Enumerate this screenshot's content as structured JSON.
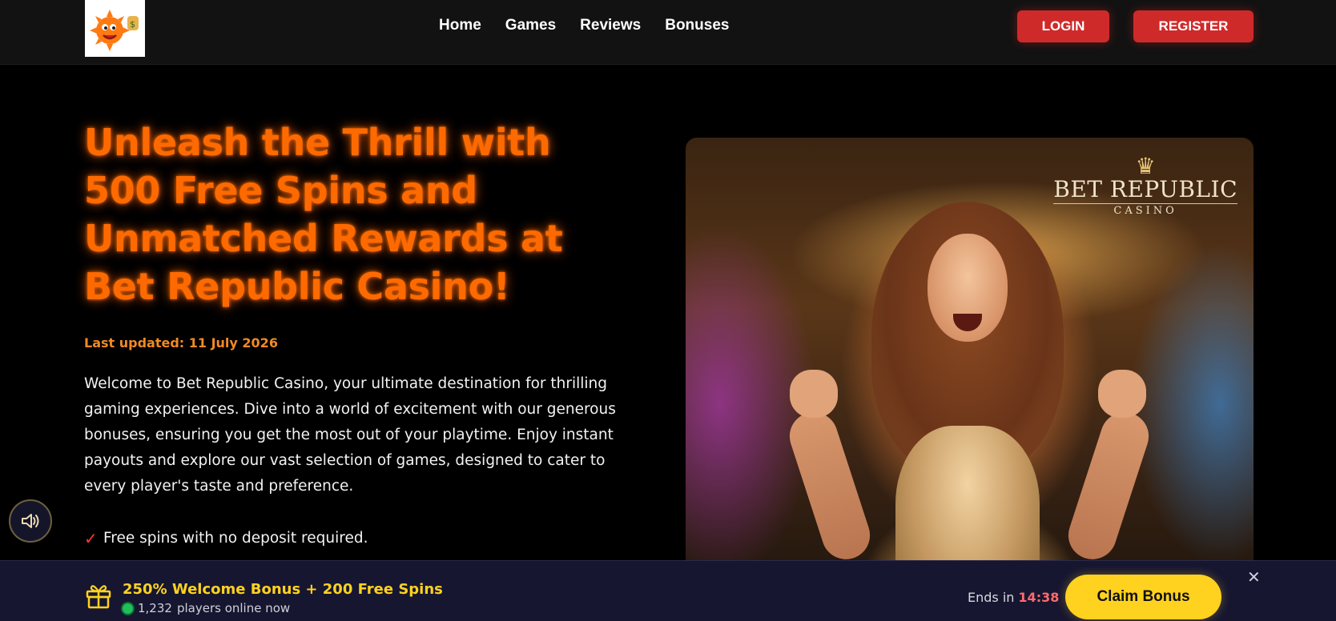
{
  "header": {
    "nav": [
      "Home",
      "Games",
      "Reviews",
      "Bonuses"
    ],
    "login_label": "LOGIN",
    "register_label": "REGISTER",
    "accent_color": "#cf2a2a"
  },
  "hero": {
    "title": "Unleash the Thrill with 500 Free Spins and Unmatched Rewards at Bet Republic Casino!",
    "updated": "Last updated: 11 July 2026",
    "intro": "Welcome to Bet Republic Casino, your ultimate destination for thrilling gaming experiences. Dive into a world of excitement with our generous bonuses, ensuring you get the most out of your playtime. Enjoy instant payouts and explore our vast selection of games, designed to cater to every player's taste and preference.",
    "features": [
      "Free spins with no deposit required."
    ],
    "check_glyph": "✓",
    "title_color": "#ff6a00",
    "image": {
      "brand_name": "BET REPUBLIC",
      "brand_sub": "CASINO"
    }
  },
  "bonus_bar": {
    "title": "250% Welcome Bonus + 200 Free Spins",
    "online_count": "1,232",
    "online_text": "players online now",
    "ends_label": "Ends in",
    "timer": "14:38",
    "claim_label": "Claim Bonus",
    "close_glyph": "✕",
    "accent_color": "#ffd21f"
  },
  "icons": {
    "logo": "sun-mascot-logo-icon",
    "sound": "speaker-icon",
    "gift": "gift-icon",
    "online": "online-dot-icon"
  }
}
